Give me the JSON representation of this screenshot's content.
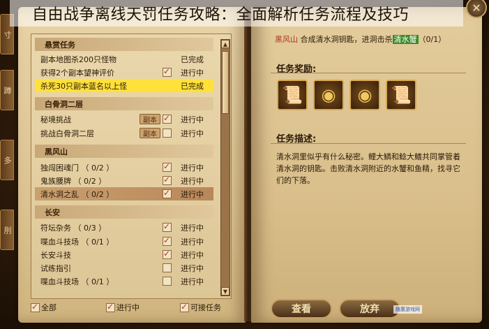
{
  "title": "自由战争离线天罚任务攻略：全面解析任务流程及技巧",
  "side_tabs": [
    "寸",
    "蹲",
    "多",
    "刖"
  ],
  "quest_list": [
    {
      "type": "cat",
      "name": "悬赏任务"
    },
    {
      "type": "item",
      "name": "副本地图杀200只怪物",
      "badge": "",
      "checked": null,
      "status": "已完成"
    },
    {
      "type": "item",
      "name": "获得2个副本望神评价",
      "badge": "",
      "checked": true,
      "status": "进行中"
    },
    {
      "type": "item",
      "name": "杀死30只副本蓝名以上怪",
      "badge": "",
      "checked": null,
      "status": "已完成",
      "highlight": true
    },
    {
      "type": "cat",
      "name": "白骨洞二层"
    },
    {
      "type": "item",
      "name": "秘境挑战",
      "badge": "副本",
      "checked": true,
      "status": "进行中"
    },
    {
      "type": "item",
      "name": "挑战白骨洞二层",
      "badge": "副本",
      "checked": false,
      "status": "进行中"
    },
    {
      "type": "cat",
      "name": "黑风山"
    },
    {
      "type": "item",
      "name": "独闯困魂门 （ 0/2 ）",
      "badge": "",
      "checked": true,
      "status": "进行中"
    },
    {
      "type": "item",
      "name": "鬼族腰牌 （ 0/2 ）",
      "badge": "",
      "checked": true,
      "status": "进行中"
    },
    {
      "type": "item",
      "name": "清水洞之乱 （ 0/2 ）",
      "badge": "",
      "checked": true,
      "status": "进行中",
      "selected": true
    },
    {
      "type": "cat",
      "name": "长安"
    },
    {
      "type": "item",
      "name": "符坛杂务 （ 0/3 ）",
      "badge": "",
      "checked": true,
      "status": "进行中"
    },
    {
      "type": "item",
      "name": "喋血斗技场 （ 0/1 ）",
      "badge": "",
      "checked": true,
      "status": "进行中"
    },
    {
      "type": "item",
      "name": "长安斗技",
      "badge": "",
      "checked": true,
      "status": "进行中"
    },
    {
      "type": "item",
      "name": "试练指引",
      "badge": "",
      "checked": false,
      "status": "进行中"
    },
    {
      "type": "item",
      "name": "喋血斗技场 （ 0/1 ）",
      "badge": "",
      "checked": false,
      "status": "进行中"
    }
  ],
  "filters": {
    "all": "全部",
    "in_progress": "进行中",
    "available": "可接任务"
  },
  "objective": {
    "location": "黑风山",
    "text_before": "合成清水洞钥匙，进洞击杀",
    "target": "清水蟹",
    "count": "（0/1）"
  },
  "rewards_title": "任务奖励:",
  "rewards": [
    "scroll-icon",
    "coin-icon",
    "coin-icon",
    "scroll-icon"
  ],
  "desc_title": "任务描述:",
  "description": "清水洞里似乎有什么秘密。鲤大鳞和鲶大鳍共同掌管着清水洞的钥匙。击败清水洞附近的水蟹和鱼精，找寻它们的下落。",
  "buttons": {
    "view": "查看",
    "abandon": "放弃"
  },
  "watermark": "趣惠游戏网"
}
